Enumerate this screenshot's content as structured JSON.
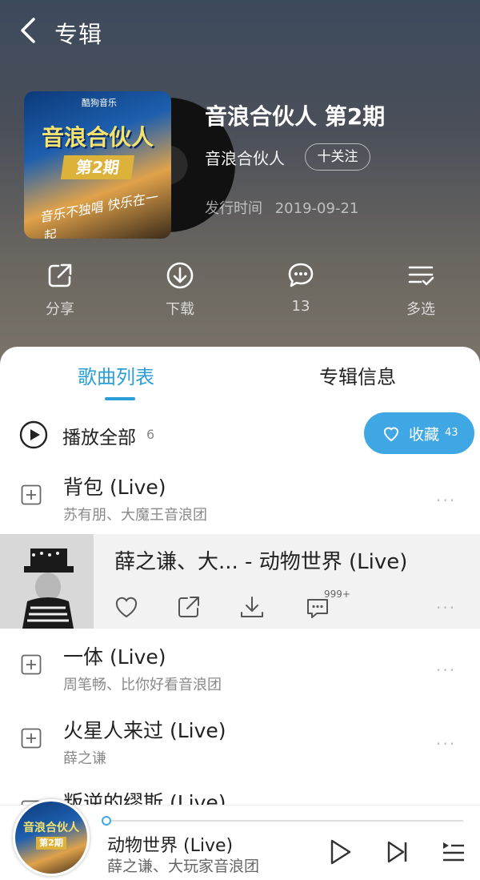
{
  "header": {
    "title": "专辑"
  },
  "album": {
    "cover_text_line1": "音浪合伙人",
    "cover_text_line2": "第2期",
    "cover_text_line3": "音乐不独唱 快乐在一起",
    "cover_logo": "酷狗音乐",
    "name": "音浪合伙人 第2期",
    "artist": "音浪合伙人",
    "follow_label": "十关注",
    "release_label": "发行时间",
    "release_date": "2019-09-21"
  },
  "actions": {
    "share_label": "分享",
    "download_label": "下载",
    "comment_count": "13",
    "multiselect_label": "多选"
  },
  "tabs": {
    "songs_label": "歌曲列表",
    "info_label": "专辑信息"
  },
  "playall": {
    "label": "播放全部",
    "count": "6"
  },
  "collect": {
    "label": "收藏",
    "count": "43"
  },
  "songs": [
    {
      "title": "背包 (Live)",
      "artist": "苏有朋、大魔王音浪团"
    },
    {
      "title": "一体 (Live)",
      "artist": "周笔畅、比你好看音浪团"
    },
    {
      "title": "火星人来过 (Live)",
      "artist": "薛之谦"
    },
    {
      "title": "叛逆的缪斯 (Live)",
      "artist": ""
    }
  ],
  "active_song": {
    "title": "薛之谦、大... - 动物世界 (Live)",
    "comment_badge": "999+"
  },
  "player": {
    "disc_text_line1": "音浪合伙人",
    "disc_text_line2": "第2期",
    "title": "动物世界 (Live)",
    "artist": "薛之谦、大玩家音浪团",
    "progress": 0.0
  },
  "colors": {
    "accent": "#2b9ed8",
    "collect_bg": "#3fa8e4"
  }
}
